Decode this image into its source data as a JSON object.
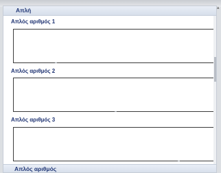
{
  "section": {
    "title": "Απλή"
  },
  "fields": [
    {
      "label": "Απλός αριθμός 1",
      "value": ""
    },
    {
      "label": "Απλός αριθμός 2",
      "value": ""
    },
    {
      "label": "Απλός αριθμός 3",
      "value": ""
    }
  ],
  "next_section": {
    "title": "Απλός αριθμός"
  },
  "icons": {
    "scroll_up": "chevron-up-icon"
  },
  "colors": {
    "header_text": "#243a78",
    "label_text": "#1f3372",
    "textbox_border": "#3a3a3a"
  }
}
